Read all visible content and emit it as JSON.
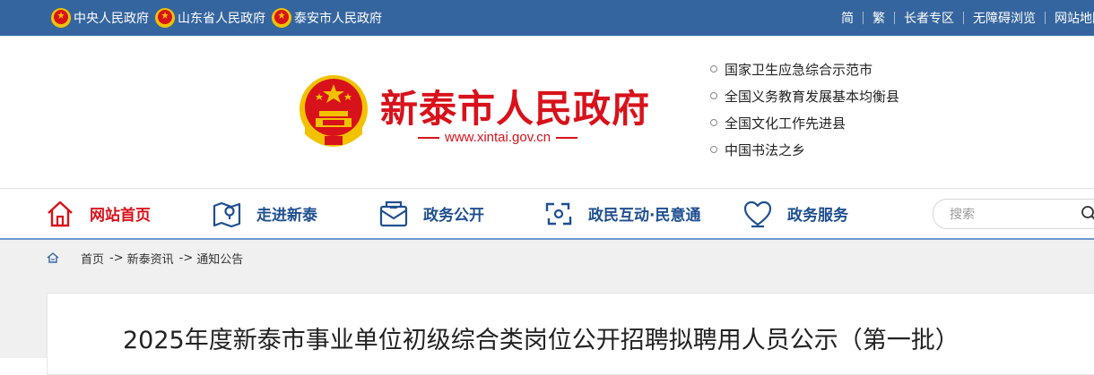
{
  "topbar": {
    "links": [
      {
        "label": "中央人民政府",
        "icon": "national-emblem-icon"
      },
      {
        "label": "山东省人民政府",
        "icon": "national-emblem-icon"
      },
      {
        "label": "泰安市人民政府",
        "icon": "national-emblem-icon"
      }
    ],
    "tools": [
      "简",
      "繁",
      "长者专区",
      "无障碍浏览",
      "网站地图"
    ]
  },
  "header": {
    "site_name": "新泰市人民政府",
    "site_url": "www.xintai.gov.cn",
    "honors": [
      "国家卫生应急综合示范市",
      "全国义务教育发展基本均衡县",
      "全国文化工作先进县",
      "中国书法之乡"
    ]
  },
  "nav": {
    "items": [
      {
        "label": "网站首页",
        "icon": "home-icon",
        "active": true
      },
      {
        "label": "走进新泰",
        "icon": "map-icon",
        "active": false
      },
      {
        "label": "政务公开",
        "icon": "mail-icon",
        "active": false
      },
      {
        "label": "政民互动·民意通",
        "icon": "interaction-icon",
        "active": false
      },
      {
        "label": "政务服务",
        "icon": "heart-icon",
        "active": false
      }
    ],
    "search_placeholder": "搜索"
  },
  "breadcrumb": {
    "items": [
      "首页",
      "新泰资讯",
      "通知公告"
    ],
    "separator": "->"
  },
  "article": {
    "title": "2025年度新泰市事业单位初级综合类岗位公开招聘拟聘用人员公示（第一批）"
  },
  "colors": {
    "topbar_bg": "#35659f",
    "brand_red": "#d8121b",
    "nav_blue": "#1e4f8f",
    "nav_underline": "#6e96c8"
  }
}
